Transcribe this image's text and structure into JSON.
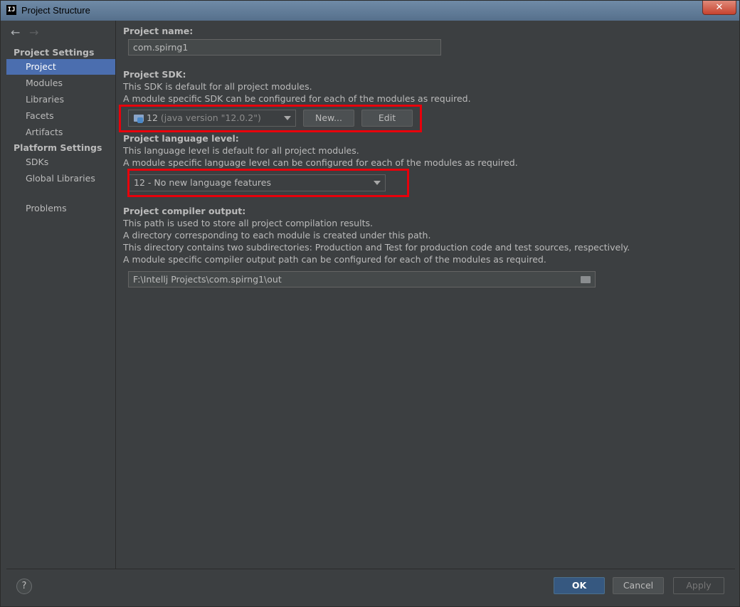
{
  "window": {
    "title": "Project Structure"
  },
  "sidebar": {
    "project_settings_header": "Project Settings",
    "project_settings_items": [
      "Project",
      "Modules",
      "Libraries",
      "Facets",
      "Artifacts"
    ],
    "platform_settings_header": "Platform Settings",
    "platform_settings_items": [
      "SDKs",
      "Global Libraries"
    ],
    "problems": "Problems",
    "selected": "Project"
  },
  "project_name": {
    "label": "Project name:",
    "value": "com.spirng1"
  },
  "project_sdk": {
    "label": "Project SDK:",
    "desc1": "This SDK is default for all project modules.",
    "desc2": "A module specific SDK can be configured for each of the modules as required.",
    "selected_version": "12",
    "selected_detail": "(java version \"12.0.2\")",
    "new_button": "New...",
    "edit_button": "Edit"
  },
  "language_level": {
    "label": "Project language level:",
    "desc1": "This language level is default for all project modules.",
    "desc2": "A module specific language level can be configured for each of the modules as required.",
    "selected": "12 - No new language features"
  },
  "compiler_output": {
    "label": "Project compiler output:",
    "desc1": "This path is used to store all project compilation results.",
    "desc2": "A directory corresponding to each module is created under this path.",
    "desc3": "This directory contains two subdirectories: Production and Test for production code and test sources, respectively.",
    "desc4": "A module specific compiler output path can be configured for each of the modules as required.",
    "path": "F:\\Intellj Projects\\com.spirng1\\out"
  },
  "footer": {
    "help": "?",
    "ok": "OK",
    "cancel": "Cancel",
    "apply": "Apply"
  },
  "colors": {
    "highlight_box": "#e8000b",
    "selection": "#4b6eaf",
    "background": "#3c3f41"
  }
}
